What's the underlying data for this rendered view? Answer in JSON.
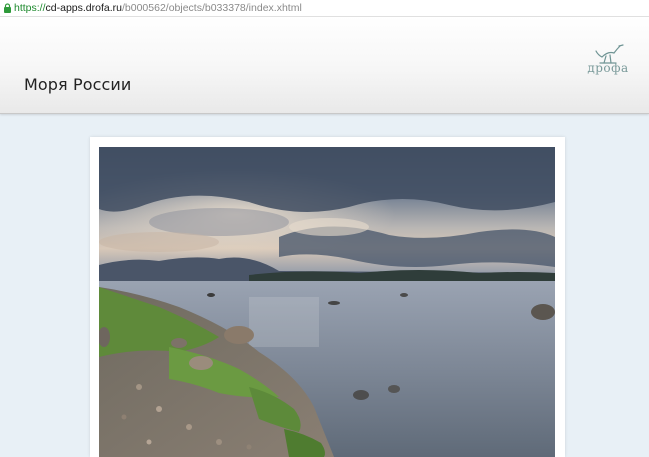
{
  "browser": {
    "url_scheme": "https://",
    "url_host": "cd-apps.drofa.ru",
    "url_path": "/b000562/objects/b033378/index.xhtml"
  },
  "header": {
    "title": "Моря России",
    "logo_text": "дрофа"
  },
  "main": {
    "image_subject": "Seashore landscape: cloudy sky, distant hills, calm water, rocky shore with grass"
  },
  "colors": {
    "page_background": "#e8f0f6",
    "url_scheme": "#1e8a2e",
    "logo": "#7a9a9a"
  },
  "icons": [
    "lock-icon",
    "drofa-logo-bird-icon"
  ]
}
